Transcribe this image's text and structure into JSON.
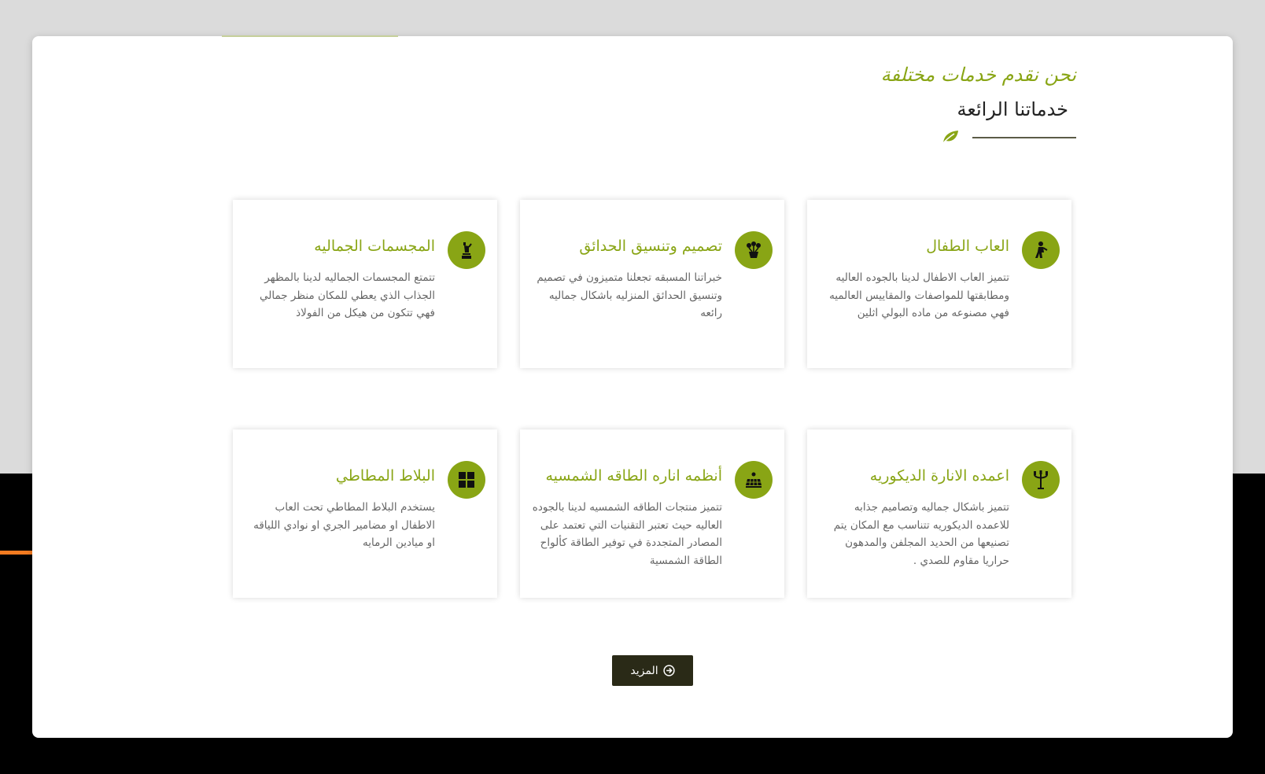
{
  "section": {
    "subtitle": "نحن نقدم خدمات مختلفة",
    "title": "خدماتنا الرائعة"
  },
  "cards": [
    {
      "icon": "child-icon",
      "title": "العاب الطفال",
      "text": "تتميز العاب الاطفال لدينا بالجوده العاليه ومطابقتها للمواصفات والمقاييس العالميه فهي مصنوعه من ماده البولي اثلين"
    },
    {
      "icon": "flower-pot-icon",
      "title": "تصميم وتنسيق الحدائق",
      "text": "خبراتنا المسبقه تجعلنا متميزون في تصميم وتنسيق الحدائق المنزليه باشكال جماليه رائعه"
    },
    {
      "icon": "statue-icon",
      "title": "المجسمات الجماليه",
      "text": "تتمتع المجسمات الجماليه لدينا بالمظهر الجذاب الذي يعطي للمكان منظر جمالي فهي تتكون من هيكل من الفولاذ"
    },
    {
      "icon": "lamp-post-icon",
      "title": "اعمده الانارة الديكوريه",
      "text": "تتميز باشكال جماليه وتصاميم جذابه للاعمده الديكوريه تتناسب مع المكان يتم تصنيعها من الحديد المجلفن والمدهون حراريا مقاوم للصدي ."
    },
    {
      "icon": "solar-panel-icon",
      "title": "أنظمه اناره الطاقه الشمسيه",
      "text": "تتميز منتجات الطاقه الشمسيه لدينا بالجوده العاليه حيث تعتبر التقنيات التي تعتمد على المصادر المتجددة في توفير الطاقة كألواح الطاقة الشمسية"
    },
    {
      "icon": "tiles-icon",
      "title": "البلاط المطاطي",
      "text": "يستخدم البلاط المطاطي تحت العاب الاطفال او مضامير الجري او نوادي اللياقه او ميادين الرمايه"
    }
  ],
  "more_button": {
    "label": "المزيد",
    "icon": "arrow-circle-right-icon"
  },
  "colors": {
    "accent": "#89a515",
    "button_bg": "#2a2a17",
    "heading": "#222222",
    "body_text": "#666666",
    "orange_line": "#f47b20"
  }
}
